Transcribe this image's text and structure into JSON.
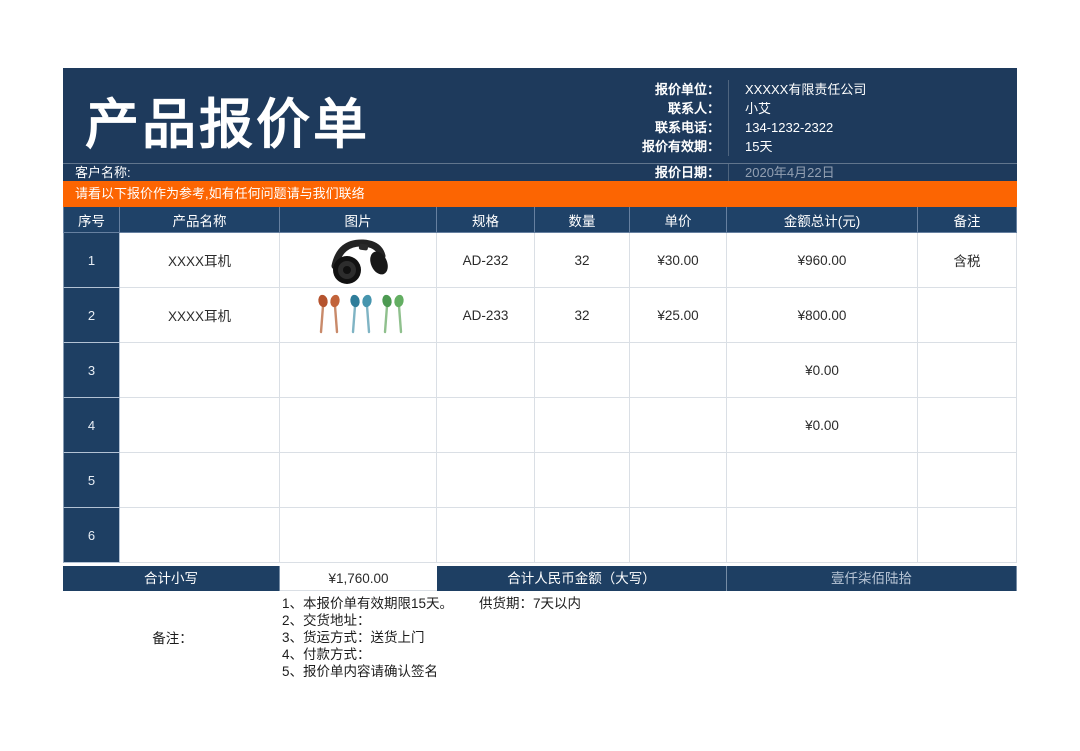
{
  "title_bar": {
    "title": "产品报价单"
  },
  "quote_info": {
    "rows": [
      {
        "label": "报价单位：",
        "value": "XXXXX有限责任公司"
      },
      {
        "label": "联系人：",
        "value": "小艾"
      },
      {
        "label": "联系电话：",
        "value": "134-1232-2322"
      },
      {
        "label": "报价有效期：",
        "value": "15天"
      }
    ],
    "date_label": "报价日期：",
    "date_value": "2020年4月22日"
  },
  "customer": {
    "label": "客户名称:"
  },
  "notice": {
    "text": "请看以下报价作为参考,如有任何问题请与我们联络"
  },
  "table": {
    "headers": [
      "序号",
      "产品名称",
      "图片",
      "规格",
      "数量",
      "单价",
      "金额总计(元)",
      "备注"
    ],
    "rows": [
      {
        "no": "1",
        "name": "XXXX耳机",
        "image": "black-overear-headphones-photo",
        "spec": "AD-232",
        "qty": "32",
        "price": "¥30.00",
        "total": "¥960.00",
        "note": "含税"
      },
      {
        "no": "2",
        "name": "XXXX耳机",
        "image": "colorful-earbuds-photo",
        "spec": "AD-233",
        "qty": "32",
        "price": "¥25.00",
        "total": "¥800.00",
        "note": ""
      },
      {
        "no": "3",
        "name": "",
        "image": "",
        "spec": "",
        "qty": "",
        "price": "",
        "total": "¥0.00",
        "note": ""
      },
      {
        "no": "4",
        "name": "",
        "image": "",
        "spec": "",
        "qty": "",
        "price": "",
        "total": "¥0.00",
        "note": ""
      },
      {
        "no": "5",
        "name": "",
        "image": "",
        "spec": "",
        "qty": "",
        "price": "",
        "total": "",
        "note": ""
      },
      {
        "no": "6",
        "name": "",
        "image": "",
        "spec": "",
        "qty": "",
        "price": "",
        "total": "",
        "note": ""
      }
    ]
  },
  "summary": {
    "label_small": "合计小写",
    "amount": "¥1,760.00",
    "label_big": "合计人民币金额（大写）",
    "amount_big": "壹仟柒佰陆拾"
  },
  "notes": {
    "label": "备注：",
    "lines": [
      {
        "text": "1、本报价单有效期限15天。",
        "extra": "供货期：7天以内"
      },
      {
        "text": "2、交货地址：",
        "extra": ""
      },
      {
        "text": "3、货运方式：送货上门",
        "extra": ""
      },
      {
        "text": "4、付款方式：",
        "extra": ""
      },
      {
        "text": "5、报价单内容请确认签名",
        "extra": ""
      }
    ]
  },
  "colors": {
    "banner_navy": "#1e3a5c",
    "header_navy": "#1f4268",
    "cell_navy": "#1e3f63",
    "orange": "#fc6502",
    "grid_line": "#dadfe5",
    "date_text": "#93a0b2",
    "big_amount_text": "#b9c6d6"
  }
}
